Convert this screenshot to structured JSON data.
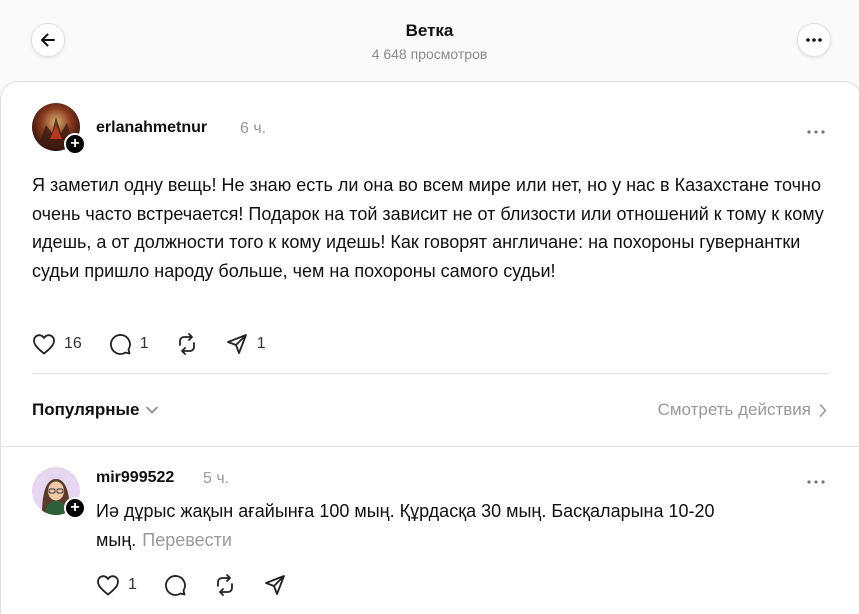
{
  "header": {
    "title": "Ветка",
    "subtitle": "4 648 просмотров"
  },
  "post": {
    "username": "erlanahmetnur",
    "time": "6 ч.",
    "text": "Я заметил одну вещь! Не знаю есть ли она во всем мире или нет, но у нас в Казахстане точно очень часто встречается! Подарок на той зависит не от близости или отношений к тому к кому идешь, а от должности того к кому идешь! Как говорят англичане: на похороны гувернантки судьи пришло народу больше, чем на похороны самого судьи!",
    "likes": "16",
    "replies": "1",
    "reposts": "",
    "shares": "1"
  },
  "sort": {
    "label": "Популярные",
    "view_activity": "Смотреть действия"
  },
  "reply": {
    "username": "mir999522",
    "time": "5 ч.",
    "text": "Иә дұрыс жақын ағайынға 100 мың. Құрдасқа 30 мың. Басқаларына 10-20 мың.",
    "translate": "Перевести",
    "likes": "1"
  },
  "icons": {
    "back": "arrow-left-icon",
    "more": "more-horizontal-icon",
    "like": "heart-icon",
    "comment": "comment-icon",
    "repost": "repost-icon",
    "share": "send-icon"
  }
}
